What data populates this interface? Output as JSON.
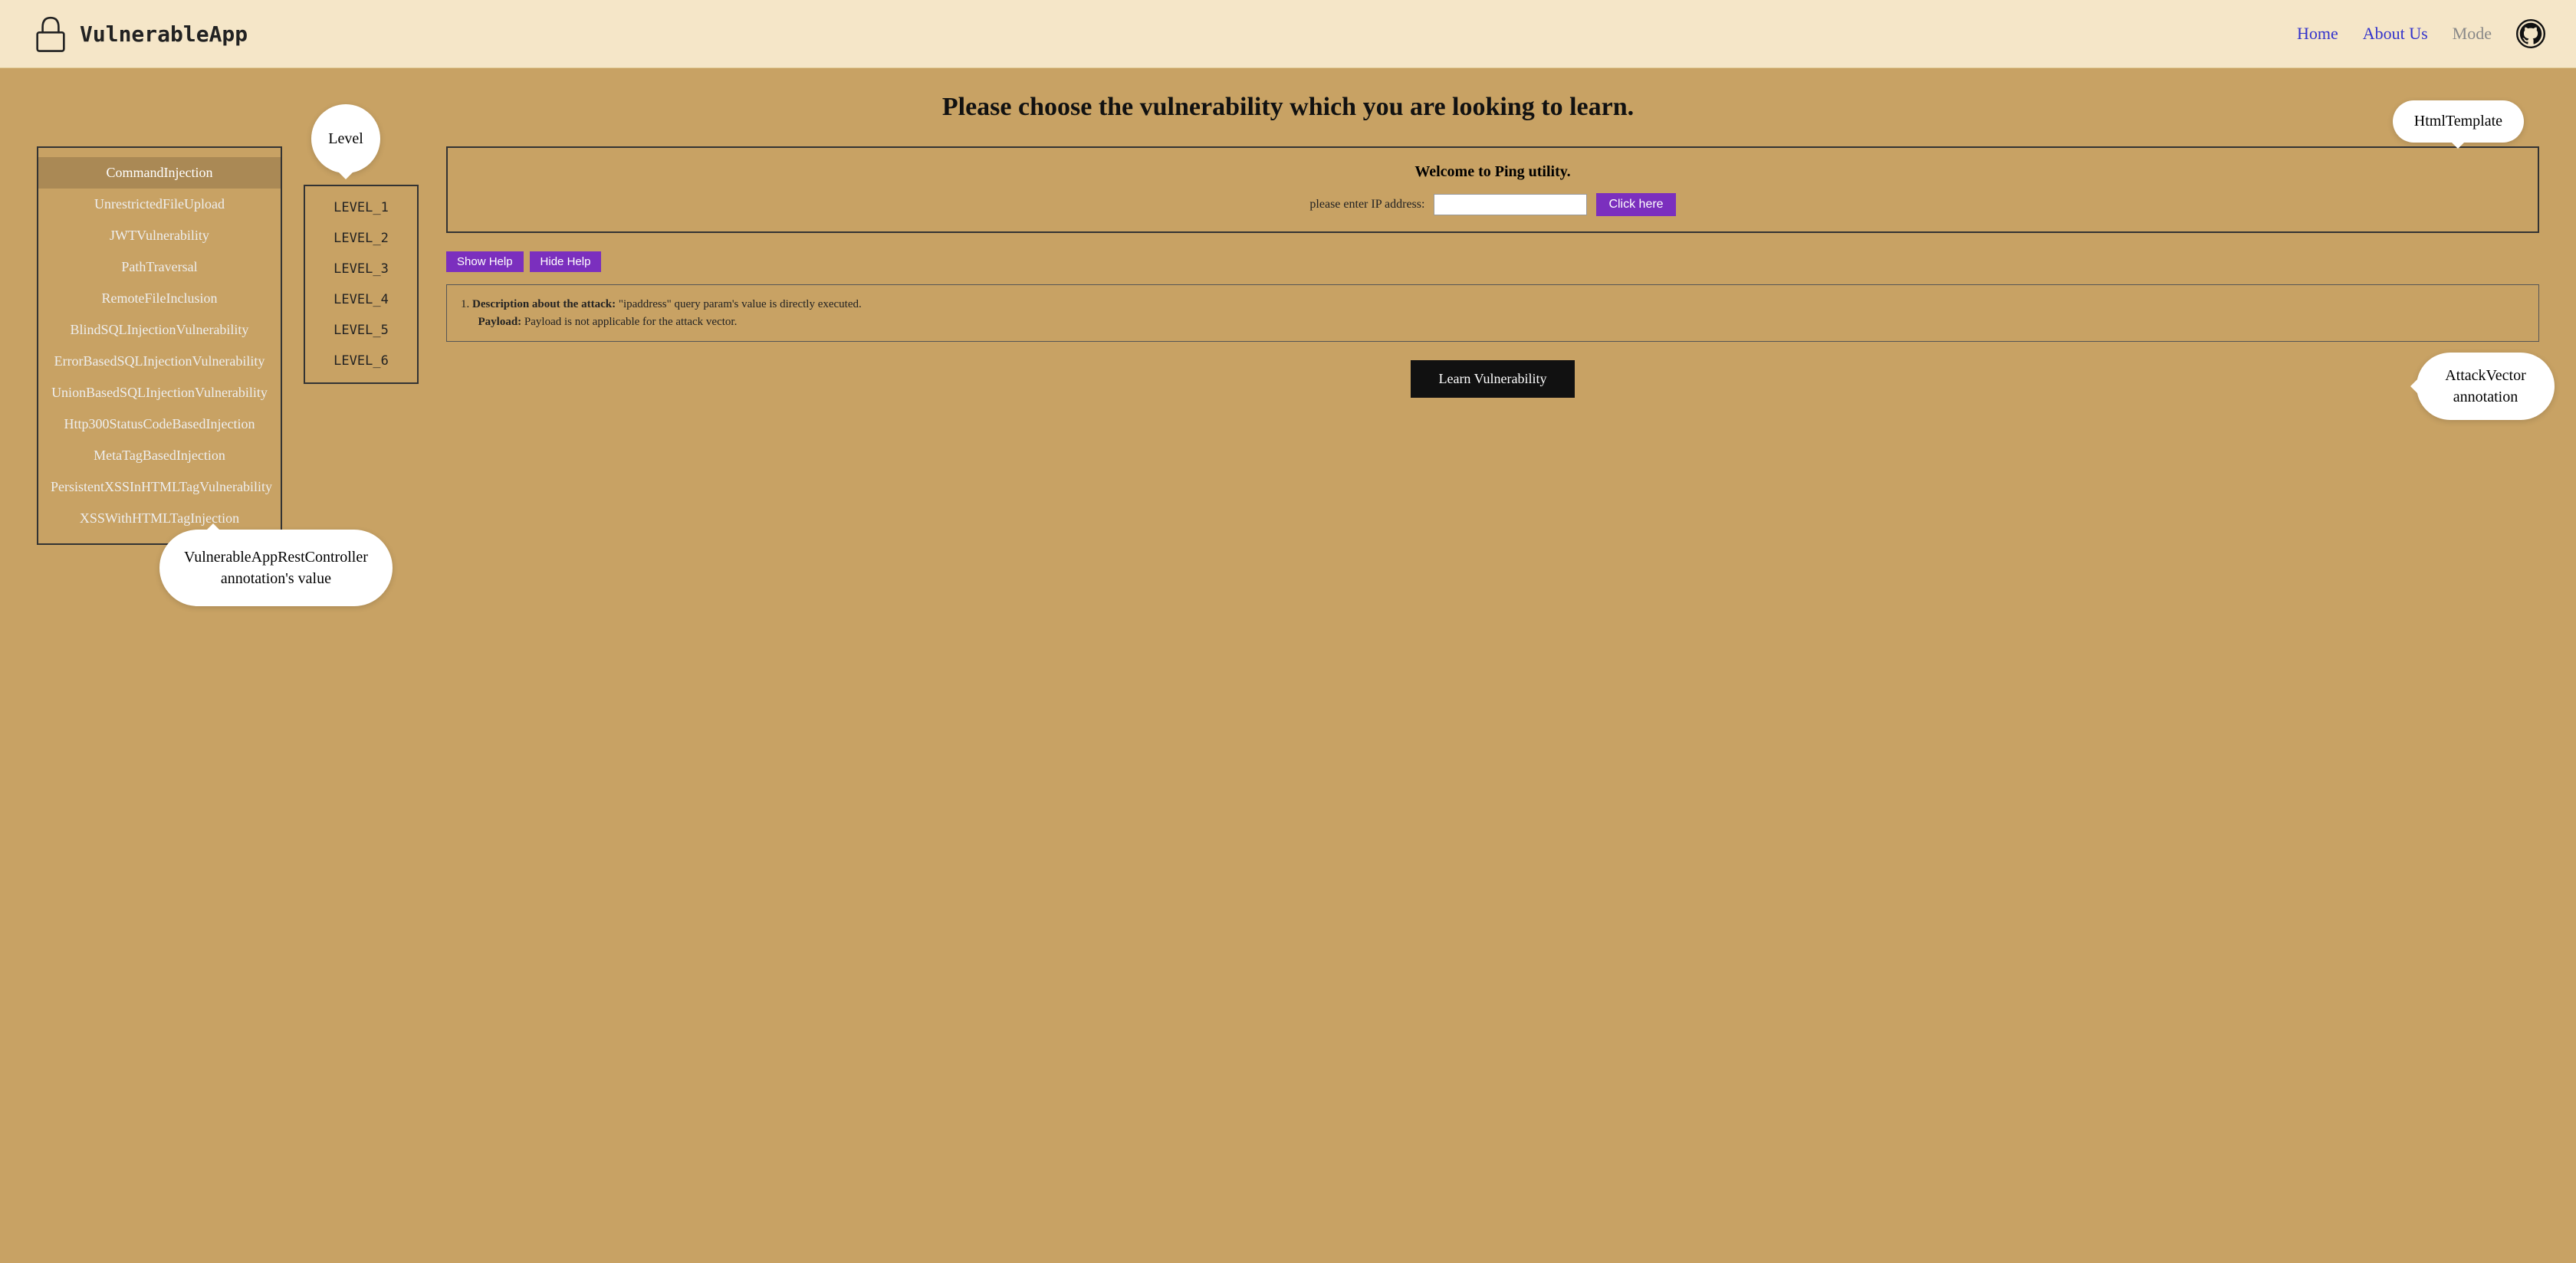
{
  "header": {
    "logo_text": "VulnerableApp",
    "nav": {
      "home": "Home",
      "about": "About Us",
      "mode": "Mode"
    }
  },
  "main": {
    "title": "Please choose the vulnerability which you are looking to learn.",
    "vulnerabilities": [
      {
        "label": "CommandInjection",
        "active": true
      },
      {
        "label": "UnrestrictedFileUpload",
        "active": false
      },
      {
        "label": "JWTVulnerability",
        "active": false
      },
      {
        "label": "PathTraversal",
        "active": false
      },
      {
        "label": "RemoteFileInclusion",
        "active": false
      },
      {
        "label": "BlindSQLInjectionVulnerability",
        "active": false
      },
      {
        "label": "ErrorBasedSQLInjectionVulnerability",
        "active": false
      },
      {
        "label": "UnionBasedSQLInjectionVulnerability",
        "active": false
      },
      {
        "label": "Http300StatusCodeBasedInjection",
        "active": false
      },
      {
        "label": "MetaTagBasedInjection",
        "active": false
      },
      {
        "label": "PersistentXSSInHTMLTagVulnerability",
        "active": false
      },
      {
        "label": "XSSWithHTMLTagInjection",
        "active": false
      }
    ],
    "level_bubble_label": "Level",
    "levels": [
      {
        "label": "LEVEL_1"
      },
      {
        "label": "LEVEL_2"
      },
      {
        "label": "LEVEL_3"
      },
      {
        "label": "LEVEL_4"
      },
      {
        "label": "LEVEL_5"
      },
      {
        "label": "LEVEL_6"
      }
    ],
    "html_template_bubble": "HtmlTemplate",
    "ping": {
      "title": "Welcome to Ping utility.",
      "label": "please enter IP address:",
      "placeholder": "",
      "button": "Click here"
    },
    "help": {
      "show_label": "Show Help",
      "hide_label": "Hide Help",
      "description_prefix": "1. ",
      "description_bold": "Description about the attack:",
      "description_text": " \"ipaddress\" query param's value is directly executed.",
      "payload_bold": "Payload:",
      "payload_text": " Payload is not applicable for the attack vector."
    },
    "learn_btn": "Learn Vulnerability",
    "attack_vector_bubble": "AttackVector\nannotation",
    "rest_controller_bubble": "VulnerableAppRestController\nannotation's value"
  }
}
